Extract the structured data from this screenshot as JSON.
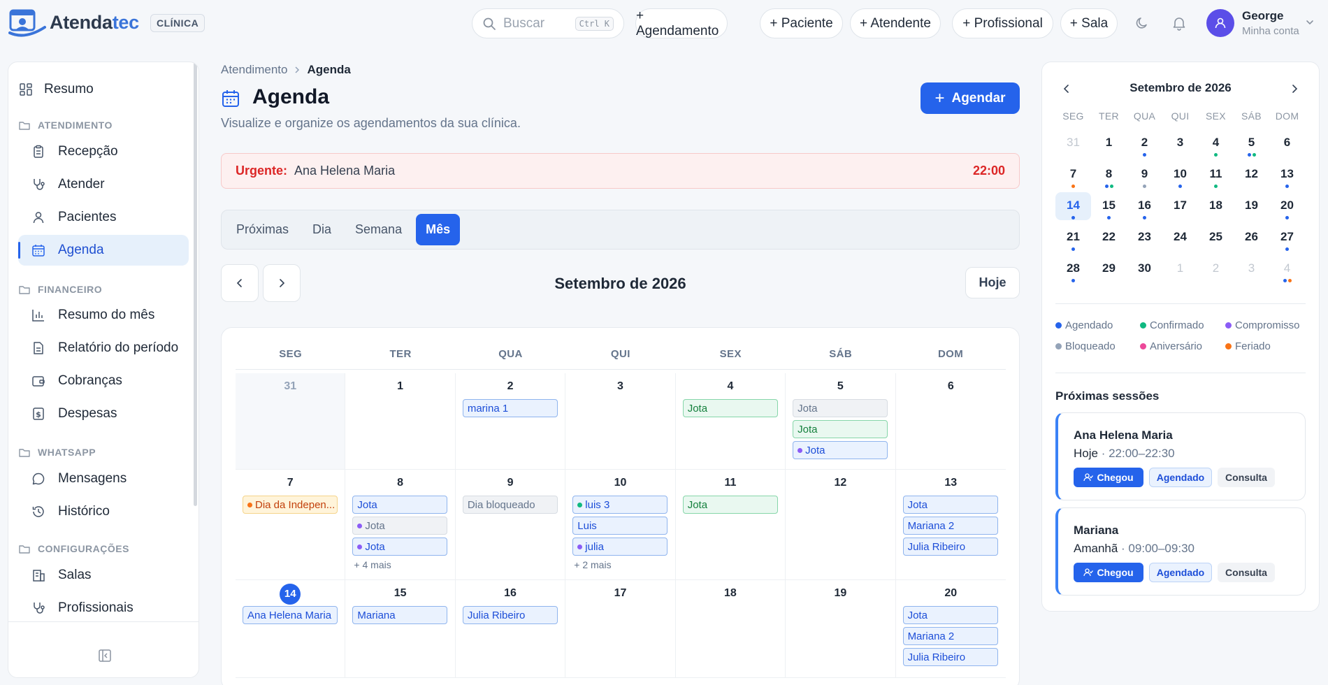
{
  "app": {
    "logo_text_a": "Atenda",
    "logo_text_b": "tec",
    "clinic_badge": "CLÍNICA"
  },
  "topbar": {
    "search_placeholder": "Buscar",
    "search_shortcut": "Ctrl K",
    "quick_actions": [
      "+ Agendamento",
      "+ Paciente",
      "+ Atendente",
      "+ Profissional",
      "+ Sala"
    ],
    "user_name": "George",
    "user_sub": "Minha conta"
  },
  "sidebar": {
    "resumo": "Resumo",
    "sections": [
      {
        "title": "ATENDIMENTO",
        "items": [
          "Recepção",
          "Atender",
          "Pacientes",
          "Agenda"
        ]
      },
      {
        "title": "FINANCEIRO",
        "items": [
          "Resumo do mês",
          "Relatório do período",
          "Cobranças",
          "Despesas"
        ]
      },
      {
        "title": "WHATSAPP",
        "items": [
          "Mensagens",
          "Histórico"
        ]
      },
      {
        "title": "CONFIGURAÇÕES",
        "items": [
          "Salas",
          "Profissionais"
        ]
      }
    ],
    "active_item": "Agenda"
  },
  "main": {
    "breadcrumb": [
      "Atendimento",
      "Agenda"
    ],
    "title": "Agenda",
    "subtitle": "Visualize e organize os agendamentos da sua clínica.",
    "primary_button": "Agendar",
    "urgent": {
      "label": "Urgente:",
      "name": "Ana Helena Maria",
      "time": "22:00"
    },
    "tabs": [
      "Próximas",
      "Dia",
      "Semana",
      "Mês"
    ],
    "active_tab": "Mês",
    "month_title": "Setembro de 2026",
    "today_button": "Hoje",
    "weekdays": [
      "SEG",
      "TER",
      "QUA",
      "QUI",
      "SEX",
      "SÁB",
      "DOM"
    ],
    "weeks": [
      [
        {
          "day": "31",
          "out": true,
          "events": []
        },
        {
          "day": "1",
          "events": []
        },
        {
          "day": "2",
          "events": [
            {
              "text": "marina 1",
              "style": "blue"
            }
          ]
        },
        {
          "day": "3",
          "events": []
        },
        {
          "day": "4",
          "events": [
            {
              "text": "Jota",
              "style": "green"
            }
          ]
        },
        {
          "day": "5",
          "events": [
            {
              "text": "Jota",
              "style": "gray"
            },
            {
              "text": "Jota",
              "style": "green"
            },
            {
              "text": "Jota",
              "style": "blue",
              "dot": "#8b5cf6"
            }
          ]
        },
        {
          "day": "6",
          "events": []
        }
      ],
      [
        {
          "day": "7",
          "events": [
            {
              "text": "Dia da Indepen...",
              "style": "orange",
              "dot": "#f97316"
            }
          ]
        },
        {
          "day": "8",
          "events": [
            {
              "text": "Jota",
              "style": "blue"
            },
            {
              "text": "Jota",
              "style": "gray",
              "dot": "#8b5cf6"
            },
            {
              "text": "Jota",
              "style": "blue",
              "dot": "#8b5cf6"
            }
          ],
          "more": "+ 4 mais"
        },
        {
          "day": "9",
          "events": [
            {
              "text": "Dia bloqueado",
              "style": "gray"
            }
          ]
        },
        {
          "day": "10",
          "events": [
            {
              "text": "luis 3",
              "style": "blue",
              "dot": "#10b981"
            },
            {
              "text": "Luis",
              "style": "blue"
            },
            {
              "text": "julia",
              "style": "blue",
              "dot": "#8b5cf6"
            }
          ],
          "more": "+ 2 mais"
        },
        {
          "day": "11",
          "events": [
            {
              "text": "Jota",
              "style": "green"
            }
          ]
        },
        {
          "day": "12",
          "events": []
        },
        {
          "day": "13",
          "events": [
            {
              "text": "Jota",
              "style": "blue"
            },
            {
              "text": "Mariana 2",
              "style": "blue"
            },
            {
              "text": "Julia Ribeiro",
              "style": "blue"
            }
          ]
        }
      ],
      [
        {
          "day": "14",
          "today": true,
          "events": [
            {
              "text": "Ana Helena Maria",
              "style": "blue"
            }
          ]
        },
        {
          "day": "15",
          "events": [
            {
              "text": "Mariana",
              "style": "blue"
            }
          ]
        },
        {
          "day": "16",
          "events": [
            {
              "text": "Julia Ribeiro",
              "style": "blue"
            }
          ]
        },
        {
          "day": "17",
          "events": []
        },
        {
          "day": "18",
          "events": []
        },
        {
          "day": "19",
          "events": []
        },
        {
          "day": "20",
          "events": [
            {
              "text": "Jota",
              "style": "blue"
            },
            {
              "text": "Mariana 2",
              "style": "blue"
            },
            {
              "text": "Julia Ribeiro",
              "style": "blue"
            }
          ]
        }
      ]
    ]
  },
  "mini_calendar": {
    "title": "Setembro de 2026",
    "weekdays": [
      "SEG",
      "TER",
      "QUA",
      "QUI",
      "SEX",
      "SÁB",
      "DOM"
    ],
    "days": [
      {
        "d": "31",
        "out": true,
        "dots": []
      },
      {
        "d": "1",
        "dots": []
      },
      {
        "d": "2",
        "dots": [
          "#2563eb"
        ]
      },
      {
        "d": "3",
        "dots": []
      },
      {
        "d": "4",
        "dots": [
          "#10b981"
        ]
      },
      {
        "d": "5",
        "dots": [
          "#2563eb",
          "#10b981"
        ]
      },
      {
        "d": "6",
        "dots": []
      },
      {
        "d": "7",
        "dots": [
          "#f97316"
        ]
      },
      {
        "d": "8",
        "dots": [
          "#2563eb",
          "#10b981"
        ]
      },
      {
        "d": "9",
        "dots": [
          "#94a3b8"
        ]
      },
      {
        "d": "10",
        "dots": [
          "#2563eb"
        ]
      },
      {
        "d": "11",
        "dots": [
          "#10b981"
        ]
      },
      {
        "d": "12",
        "dots": []
      },
      {
        "d": "13",
        "dots": [
          "#2563eb"
        ]
      },
      {
        "d": "14",
        "sel": true,
        "dots": [
          "#2563eb"
        ]
      },
      {
        "d": "15",
        "dots": [
          "#2563eb"
        ]
      },
      {
        "d": "16",
        "dots": [
          "#2563eb"
        ]
      },
      {
        "d": "17",
        "dots": []
      },
      {
        "d": "18",
        "dots": []
      },
      {
        "d": "19",
        "dots": []
      },
      {
        "d": "20",
        "dots": [
          "#2563eb"
        ]
      },
      {
        "d": "21",
        "dots": [
          "#2563eb"
        ]
      },
      {
        "d": "22",
        "dots": []
      },
      {
        "d": "23",
        "dots": []
      },
      {
        "d": "24",
        "dots": []
      },
      {
        "d": "25",
        "dots": []
      },
      {
        "d": "26",
        "dots": []
      },
      {
        "d": "27",
        "dots": [
          "#2563eb"
        ]
      },
      {
        "d": "28",
        "dots": [
          "#2563eb"
        ]
      },
      {
        "d": "29",
        "dots": []
      },
      {
        "d": "30",
        "dots": []
      },
      {
        "d": "1",
        "out": true,
        "dots": []
      },
      {
        "d": "2",
        "out": true,
        "dots": []
      },
      {
        "d": "3",
        "out": true,
        "dots": []
      },
      {
        "d": "4",
        "out": true,
        "dots": [
          "#2563eb",
          "#f97316"
        ]
      }
    ]
  },
  "legend": [
    {
      "label": "Agendado",
      "color": "#2563eb"
    },
    {
      "label": "Confirmado",
      "color": "#10b981"
    },
    {
      "label": "Compromisso",
      "color": "#8b5cf6"
    },
    {
      "label": "Bloqueado",
      "color": "#94a3b8"
    },
    {
      "label": "Aniversário",
      "color": "#ec4899"
    },
    {
      "label": "Feriado",
      "color": "#f97316"
    }
  ],
  "next_sessions": {
    "title": "Próximas sessões",
    "items": [
      {
        "name": "Ana Helena Maria",
        "when": "Hoje",
        "time": " · 22:00–22:30",
        "action": "Chegou",
        "status": "Agendado",
        "type": "Consulta"
      },
      {
        "name": "Mariana",
        "when": "Amanhã",
        "time": " · 09:00–09:30",
        "action": "Chegou",
        "status": "Agendado",
        "type": "Consulta"
      }
    ]
  },
  "colors": {
    "accent": "#2563eb",
    "urgent": "#dc2626"
  }
}
